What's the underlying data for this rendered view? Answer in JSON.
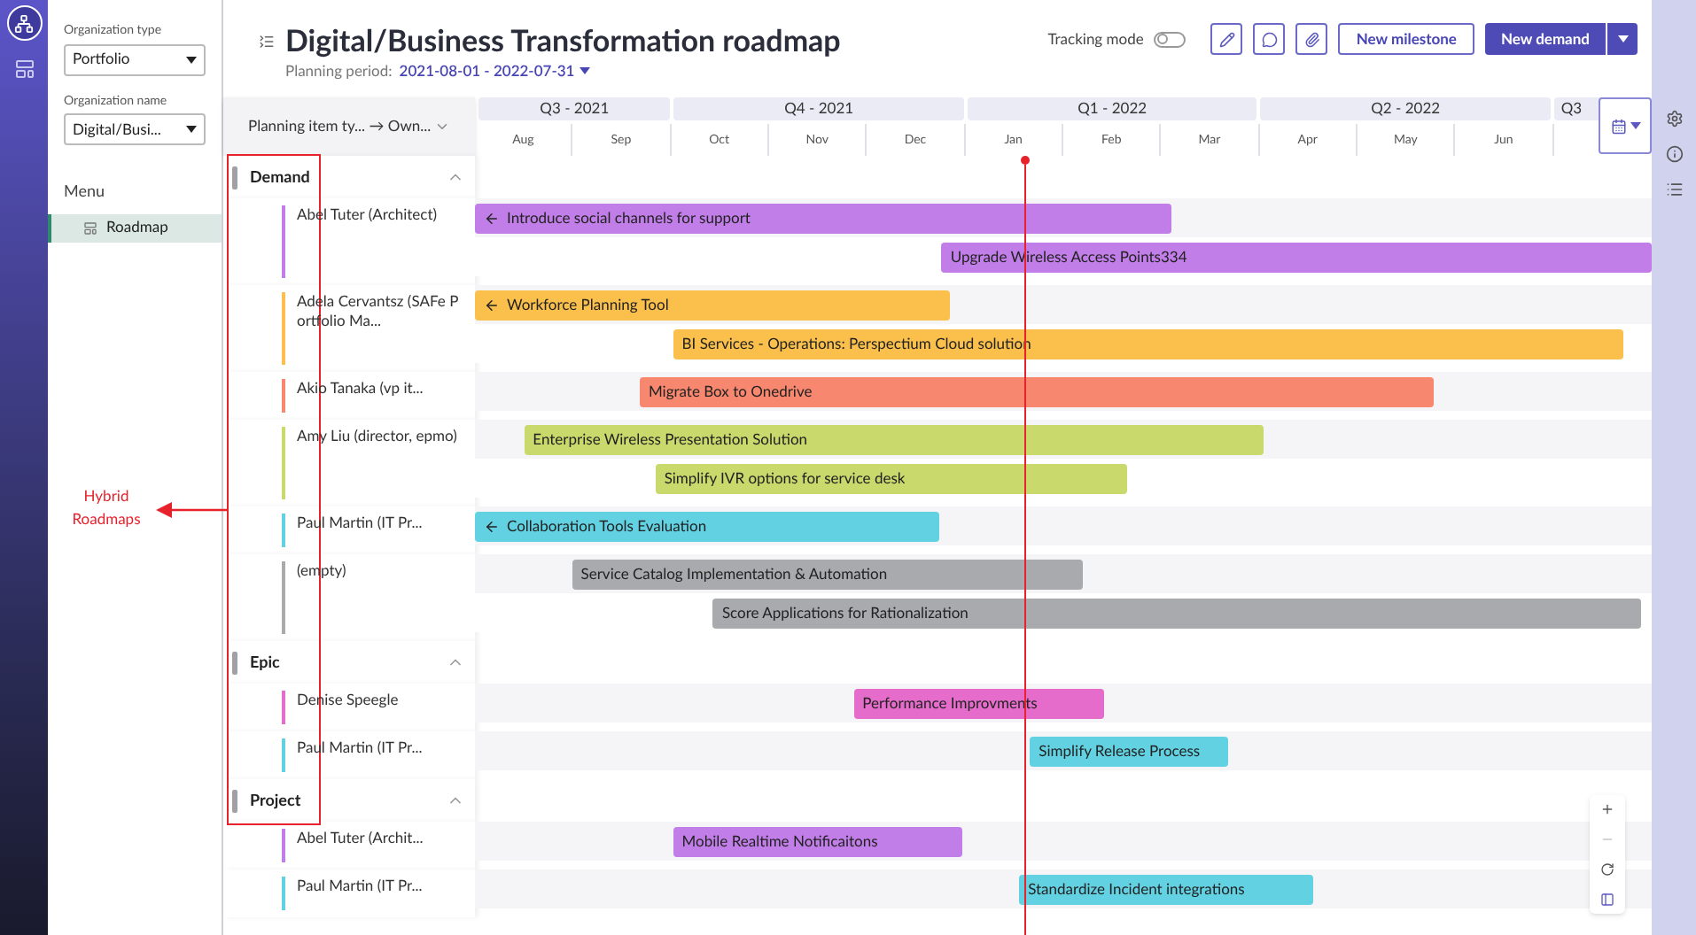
{
  "sidebar": {
    "fields": [
      {
        "label": "Organization type",
        "value": "Portfolio"
      },
      {
        "label": "Organization name",
        "value": "Digital/Busi..."
      }
    ],
    "menu_title": "Menu",
    "menu_items": [
      {
        "label": "Roadmap",
        "selected": true
      }
    ]
  },
  "header": {
    "title": "Digital/Business Transformation roadmap",
    "period_label": "Planning period:",
    "period": "2021-08-01 - 2022-07-31",
    "tracking_label": "Tracking mode",
    "tracking_on": false,
    "new_milestone": "New milestone",
    "new_demand": "New demand"
  },
  "timeline": {
    "grouping": "Planning item ty... → Own...",
    "quarters": [
      {
        "label": "Q3 - 2021",
        "months": [
          "Aug",
          "Sep"
        ]
      },
      {
        "label": "Q4 - 2021",
        "months": [
          "Oct",
          "Nov",
          "Dec"
        ]
      },
      {
        "label": "Q1 - 2022",
        "months": [
          "Jan",
          "Feb",
          "Mar"
        ]
      },
      {
        "label": "Q2 - 2022",
        "months": [
          "Apr",
          "May",
          "Jun"
        ]
      },
      {
        "label": "Q3"
      }
    ],
    "groups": [
      {
        "name": "Demand",
        "expanded": true,
        "lanes": [
          {
            "owner": "Abel Tuter (Architect)",
            "color": "#c27ee8",
            "bars": [
              {
                "label": "Introduce social channels for support",
                "continues_before": true
              },
              {
                "label": "Upgrade Wireless Access Points334",
                "continues_before": false
              }
            ]
          },
          {
            "owner": "Adela Cervantsz (SAFe Portfolio Ma...",
            "color": "#fbc04b",
            "bars": [
              {
                "label": "Workforce Planning Tool",
                "continues_before": true
              },
              {
                "label": "BI Services - Operations: Perspectium Cloud solution",
                "continues_before": false
              }
            ]
          },
          {
            "owner": "Akio Tanaka (vp it...",
            "color": "#f7876e",
            "bars": [
              {
                "label": "Migrate Box to Onedrive",
                "continues_before": false
              }
            ]
          },
          {
            "owner": "Amy Liu (director, epmo)",
            "color": "#c9d96b",
            "bars": [
              {
                "label": "Enterprise Wireless Presentation Solution",
                "continues_before": false
              },
              {
                "label": "Simplify IVR options for service desk",
                "continues_before": false
              }
            ]
          },
          {
            "owner": "Paul Martin (IT Pr...",
            "color": "#62d2e2",
            "bars": [
              {
                "label": "Collaboration Tools Evaluation",
                "continues_before": true
              }
            ]
          },
          {
            "owner": "(empty)",
            "color": "#a8aaad",
            "bars": [
              {
                "label": "Service Catalog Implementation & Automation",
                "continues_before": false
              },
              {
                "label": "Score Applications for Rationalization",
                "continues_before": false
              }
            ]
          }
        ]
      },
      {
        "name": "Epic",
        "expanded": true,
        "lanes": [
          {
            "owner": "Denise Speegle",
            "color": "#e66ccb",
            "bars": [
              {
                "label": "Performance Improvments",
                "continues_before": false
              }
            ]
          },
          {
            "owner": "Paul Martin (IT Pr...",
            "color": "#62d2e2",
            "bars": [
              {
                "label": "Simplify Release Process",
                "continues_before": false
              }
            ]
          }
        ]
      },
      {
        "name": "Project",
        "expanded": true,
        "lanes": [
          {
            "owner": "Abel Tuter (Archit...",
            "color": "#c27ee8",
            "bars": [
              {
                "label": "Mobile Realtime Notificaitons",
                "continues_before": false
              }
            ]
          },
          {
            "owner": "Paul Martin (IT Pr...",
            "color": "#62d2e2",
            "bars": [
              {
                "label": "Standardize Incident integrations",
                "continues_before": false
              }
            ]
          }
        ]
      }
    ]
  },
  "zoom_controls": {
    "zoom_out_disabled": true
  },
  "annotation": {
    "text": "Hybrid Roadmaps"
  }
}
